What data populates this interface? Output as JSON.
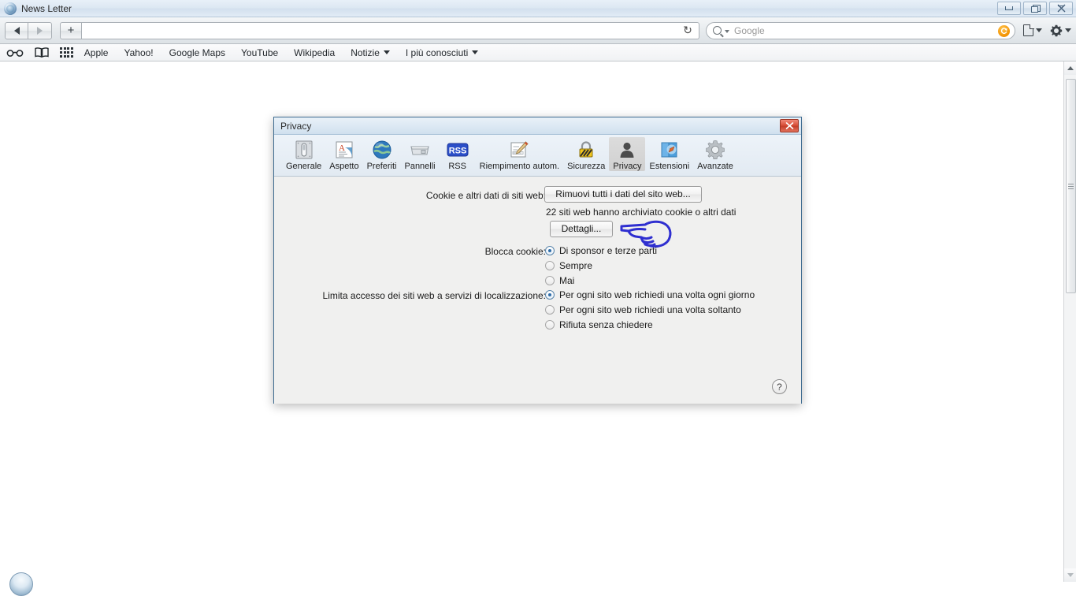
{
  "window": {
    "title": "News Letter",
    "icon": "browser-globe-icon",
    "buttons": {
      "minimize": "minimize",
      "maximize": "maximize",
      "close": "close"
    }
  },
  "toolbar": {
    "back_label": "back",
    "forward_label": "forward",
    "new_tab_label": "+",
    "address_value": "",
    "address_placeholder": "",
    "reload_glyph": "↻",
    "search_placeholder": "Google",
    "search_value": "",
    "clear_glyph": "↻",
    "page_actions_label": "page-actions",
    "settings_label": "settings"
  },
  "bookmarks_bar": {
    "icons": [
      {
        "name": "reader-glasses-icon"
      },
      {
        "name": "bookmarks-book-icon"
      },
      {
        "name": "top-sites-grid-icon"
      }
    ],
    "items": [
      {
        "label": "Apple",
        "has_menu": false
      },
      {
        "label": "Yahoo!",
        "has_menu": false
      },
      {
        "label": "Google Maps",
        "has_menu": false
      },
      {
        "label": "YouTube",
        "has_menu": false
      },
      {
        "label": "Wikipedia",
        "has_menu": false
      },
      {
        "label": "Notizie",
        "has_menu": true
      },
      {
        "label": "I più conosciuti",
        "has_menu": true
      }
    ]
  },
  "dialog": {
    "title": "Privacy",
    "close_glyph": "✕",
    "toolbar_items": [
      {
        "label": "Generale",
        "icon": "general-switch-icon",
        "selected": false
      },
      {
        "label": "Aspetto",
        "icon": "appearance-font-icon",
        "selected": false
      },
      {
        "label": "Preferiti",
        "icon": "bookmarks-globe-icon",
        "selected": false
      },
      {
        "label": "Pannelli",
        "icon": "tabs-icon",
        "selected": false
      },
      {
        "label": "RSS",
        "icon": "rss-icon",
        "selected": false
      },
      {
        "label": "Riempimento autom.",
        "icon": "autofill-pencil-icon",
        "selected": false
      },
      {
        "label": "Sicurezza",
        "icon": "security-padlock-icon",
        "selected": false
      },
      {
        "label": "Privacy",
        "icon": "privacy-person-icon",
        "selected": true
      },
      {
        "label": "Estensioni",
        "icon": "extensions-puzzle-icon",
        "selected": false
      },
      {
        "label": "Avanzate",
        "icon": "advanced-gear-icon",
        "selected": false
      }
    ],
    "cookies": {
      "label": "Cookie e altri dati di siti web:",
      "remove_all_button": "Rimuovi tutti i dati del sito web...",
      "status_text": "22 siti web hanno archiviato cookie o altri dati",
      "details_button": "Dettagli..."
    },
    "block_cookies": {
      "label": "Blocca cookie:",
      "options": [
        {
          "label": "Di sponsor e terze parti",
          "selected": true
        },
        {
          "label": "Sempre",
          "selected": false
        },
        {
          "label": "Mai",
          "selected": false
        }
      ]
    },
    "location_access": {
      "label": "Limita accesso dei siti web a servizi di localizzazione:",
      "options": [
        {
          "label": "Per ogni sito web richiedi una volta ogni giorno",
          "selected": true
        },
        {
          "label": "Per ogni sito web richiedi una volta soltanto",
          "selected": false
        },
        {
          "label": "Rifiuta senza chiedere",
          "selected": false
        }
      ]
    },
    "help_button": "?"
  },
  "annotation": {
    "name": "pointing-hand-annotation",
    "color": "#2f2fd0",
    "points_to": "Dettagli..."
  },
  "scrollbar": {
    "up_arrow": "▲",
    "down_arrow": "▼",
    "position": "top"
  },
  "colors": {
    "title_bar": "#dde8f3",
    "dialog_bg": "#f0f0ef",
    "dialog_border": "#3f6c91",
    "accent_radio": "#2f6da8",
    "close_button": "#d9503a",
    "annotation_blue": "#2f2fd0",
    "rss_blue": "#2b4fc8",
    "search_clear_orange": "#f39200"
  }
}
